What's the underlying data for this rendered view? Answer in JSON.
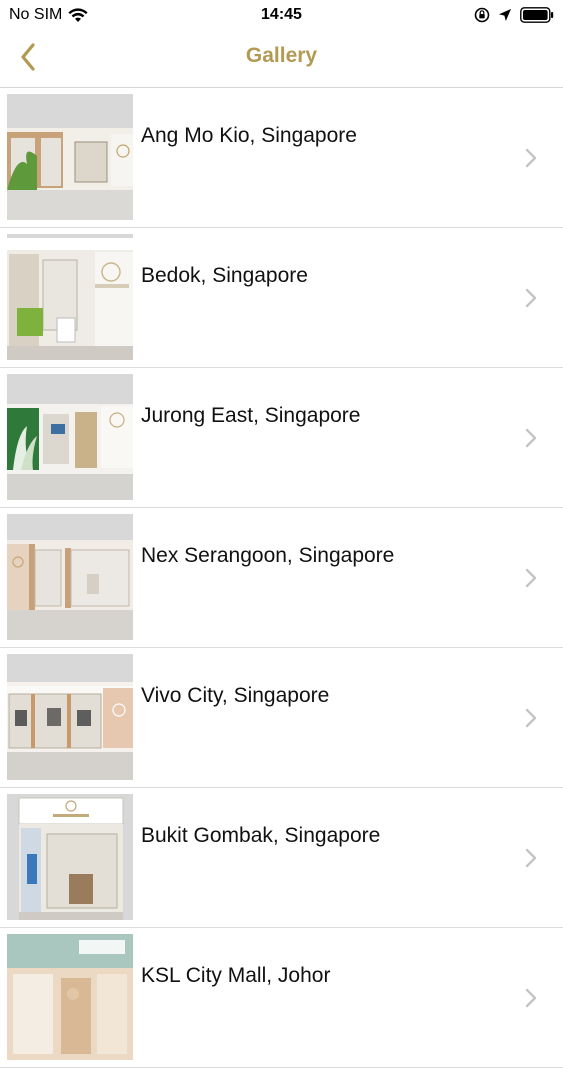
{
  "status_bar": {
    "carrier": "No SIM",
    "time": "14:45"
  },
  "nav": {
    "title": "Gallery",
    "back_icon": "chevron-left-icon",
    "accent_color": "#b39a52"
  },
  "items": [
    {
      "label": "Ang Mo Kio, Singapore",
      "thumbnail": "store-photo"
    },
    {
      "label": "Bedok, Singapore",
      "thumbnail": "store-photo"
    },
    {
      "label": "Jurong East, Singapore",
      "thumbnail": "store-photo"
    },
    {
      "label": "Nex Serangoon, Singapore",
      "thumbnail": "store-photo"
    },
    {
      "label": "Vivo City, Singapore",
      "thumbnail": "store-photo"
    },
    {
      "label": "Bukit Gombak, Singapore",
      "thumbnail": "store-photo"
    },
    {
      "label": "KSL City Mall, Johor",
      "thumbnail": "store-photo"
    }
  ]
}
